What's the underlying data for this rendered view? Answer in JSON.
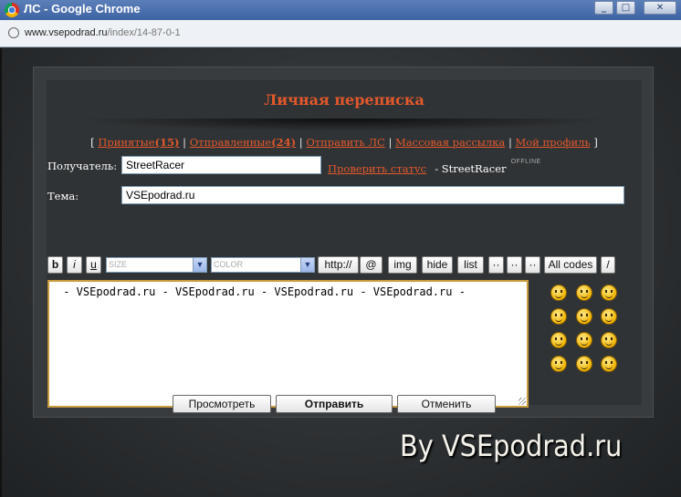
{
  "window": {
    "title": "ЛС - Google Chrome",
    "minimize_icon": "minimize-icon",
    "maximize_icon": "maximize-icon",
    "close_icon": "close-icon"
  },
  "address": {
    "host": "www.vsepodrad.ru",
    "path": "/index/14-87-0-1"
  },
  "panel": {
    "title": "Личная переписка"
  },
  "nav": {
    "open": "[",
    "received": "Принятые",
    "received_count": "(15)",
    "sent": "Отправленные",
    "sent_count": "(24)",
    "send_pm": "Отправить ЛС",
    "mass_mail": "Массовая рассылка",
    "my_profile": "Мой профиль",
    "sep": "|",
    "close": "]"
  },
  "form": {
    "recipient_label": "Получатель:",
    "recipient_value": "StreetRacer",
    "check_status": "Проверить статус",
    "status_user": "- StreetRacer",
    "status_badge": "OFFLINE",
    "subject_label": "Тема:",
    "subject_value": "VSEpodrad.ru",
    "message": " - VSEpodrad.ru - VSEpodrad.ru - VSEpodrad.ru - VSEpodrad.ru -"
  },
  "toolbar": {
    "bold": "b",
    "italic": "i",
    "underline": "u",
    "size": "SIZE",
    "color": "COLOR",
    "url": "http://",
    "email": "@",
    "img": "img",
    "hide": "hide",
    "list": "list",
    "dots1": "··",
    "dots2": "··",
    "dots3": "··",
    "all_codes": "All codes",
    "close_tags": "/"
  },
  "smileys": [
    "angry-smiley-icon",
    "grin-smiley-icon",
    "cool-smiley-icon",
    "shocked-smiley-icon",
    "wink-smiley-icon",
    "happy-smiley-icon",
    "sad-smiley-icon",
    "smile-smiley-icon",
    "surprised-smiley-icon",
    "tongue-smiley-icon",
    "laugh-smiley-icon",
    "rolleyes-smiley-icon"
  ],
  "buttons": {
    "preview": "Просмотреть",
    "send": "Отправить",
    "cancel": "Отменить"
  },
  "watermark": "By VSEpodrad.ru",
  "colors": {
    "accent": "#e2582c",
    "panel": "#303335"
  }
}
